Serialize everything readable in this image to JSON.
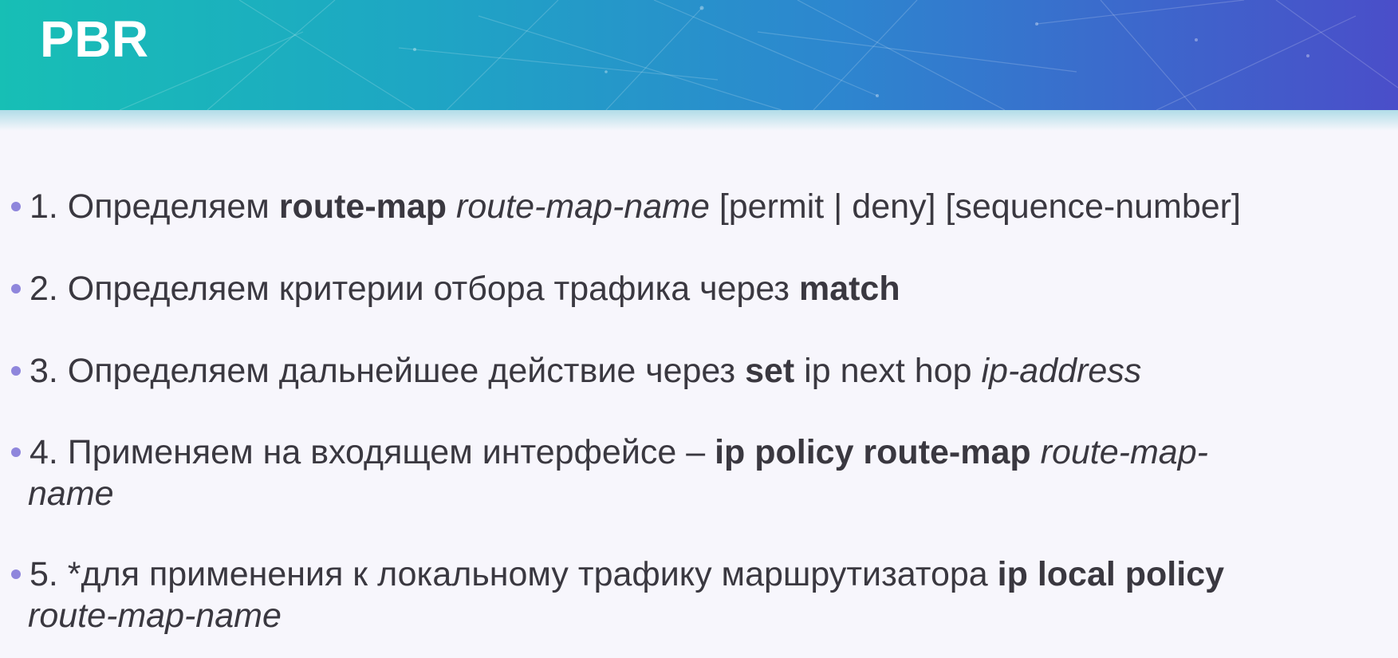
{
  "slide": {
    "title": "PBR"
  },
  "items": [
    {
      "n": "1. Определяем ",
      "kw": "route-map",
      "sp1": " ",
      "arg": "route-map-name",
      "rest": " [permit | deny] [sequence-number]"
    },
    {
      "n": "2. Определяем критерии отбора трафика через ",
      "kw": "match"
    },
    {
      "n": "3. Определяем дальнейшее действие через ",
      "kw": "set",
      "mid": " ip next hop ",
      "arg": "ip-address"
    },
    {
      "n": "4. Применяем на входящем интерфейсе – ",
      "kw": "ip policy route-map",
      "sp1": " ",
      "arg1": "route-map-",
      "arg2": "name"
    },
    {
      "n": "5. *для применения к локальному трафику маршрутизатора ",
      "kw": "ip local policy",
      "arg": "route-map-name"
    }
  ],
  "colors": {
    "header_start": "#17bfb5",
    "header_end": "#4a4ec9",
    "bullet": "#8f86dc",
    "text": "#3a3840",
    "background": "#f7f6fc"
  }
}
